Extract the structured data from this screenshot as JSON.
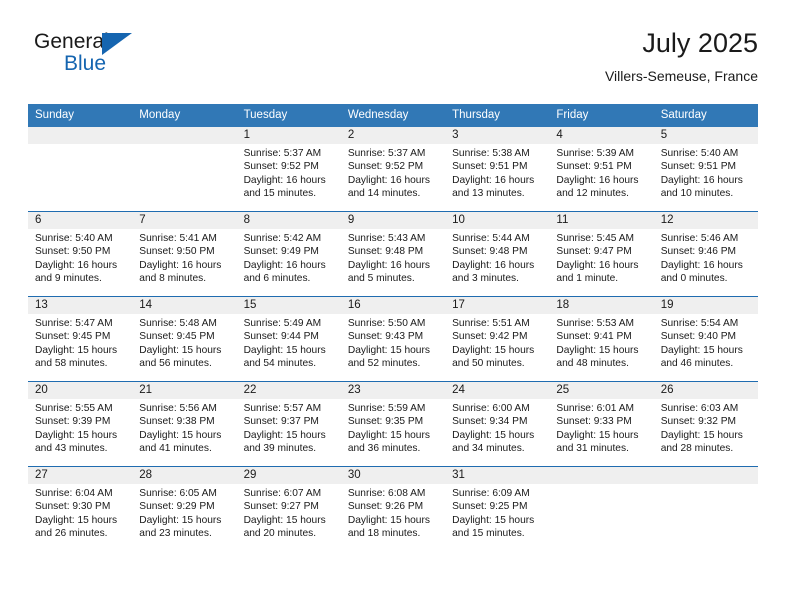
{
  "brand": {
    "name_top": "General",
    "name_bottom": "Blue",
    "flag_icon": "blue-triangle-flag-icon",
    "accent_color": "#1565b0"
  },
  "header": {
    "title": "July 2025",
    "subtitle": "Villers-Semeuse, France"
  },
  "colors": {
    "header_bar": "#3178b6",
    "row_separator": "#1f6cb0",
    "daynum_strip": "#efefef",
    "text": "#1a1a1a"
  },
  "weekday_headers": [
    "Sunday",
    "Monday",
    "Tuesday",
    "Wednesday",
    "Thursday",
    "Friday",
    "Saturday"
  ],
  "weeks": [
    [
      {
        "day": "",
        "sunrise": "",
        "sunset": "",
        "daylight_1": "",
        "daylight_2": ""
      },
      {
        "day": "",
        "sunrise": "",
        "sunset": "",
        "daylight_1": "",
        "daylight_2": ""
      },
      {
        "day": "1",
        "sunrise": "Sunrise: 5:37 AM",
        "sunset": "Sunset: 9:52 PM",
        "daylight_1": "Daylight: 16 hours",
        "daylight_2": "and 15 minutes."
      },
      {
        "day": "2",
        "sunrise": "Sunrise: 5:37 AM",
        "sunset": "Sunset: 9:52 PM",
        "daylight_1": "Daylight: 16 hours",
        "daylight_2": "and 14 minutes."
      },
      {
        "day": "3",
        "sunrise": "Sunrise: 5:38 AM",
        "sunset": "Sunset: 9:51 PM",
        "daylight_1": "Daylight: 16 hours",
        "daylight_2": "and 13 minutes."
      },
      {
        "day": "4",
        "sunrise": "Sunrise: 5:39 AM",
        "sunset": "Sunset: 9:51 PM",
        "daylight_1": "Daylight: 16 hours",
        "daylight_2": "and 12 minutes."
      },
      {
        "day": "5",
        "sunrise": "Sunrise: 5:40 AM",
        "sunset": "Sunset: 9:51 PM",
        "daylight_1": "Daylight: 16 hours",
        "daylight_2": "and 10 minutes."
      }
    ],
    [
      {
        "day": "6",
        "sunrise": "Sunrise: 5:40 AM",
        "sunset": "Sunset: 9:50 PM",
        "daylight_1": "Daylight: 16 hours",
        "daylight_2": "and 9 minutes."
      },
      {
        "day": "7",
        "sunrise": "Sunrise: 5:41 AM",
        "sunset": "Sunset: 9:50 PM",
        "daylight_1": "Daylight: 16 hours",
        "daylight_2": "and 8 minutes."
      },
      {
        "day": "8",
        "sunrise": "Sunrise: 5:42 AM",
        "sunset": "Sunset: 9:49 PM",
        "daylight_1": "Daylight: 16 hours",
        "daylight_2": "and 6 minutes."
      },
      {
        "day": "9",
        "sunrise": "Sunrise: 5:43 AM",
        "sunset": "Sunset: 9:48 PM",
        "daylight_1": "Daylight: 16 hours",
        "daylight_2": "and 5 minutes."
      },
      {
        "day": "10",
        "sunrise": "Sunrise: 5:44 AM",
        "sunset": "Sunset: 9:48 PM",
        "daylight_1": "Daylight: 16 hours",
        "daylight_2": "and 3 minutes."
      },
      {
        "day": "11",
        "sunrise": "Sunrise: 5:45 AM",
        "sunset": "Sunset: 9:47 PM",
        "daylight_1": "Daylight: 16 hours",
        "daylight_2": "and 1 minute."
      },
      {
        "day": "12",
        "sunrise": "Sunrise: 5:46 AM",
        "sunset": "Sunset: 9:46 PM",
        "daylight_1": "Daylight: 16 hours",
        "daylight_2": "and 0 minutes."
      }
    ],
    [
      {
        "day": "13",
        "sunrise": "Sunrise: 5:47 AM",
        "sunset": "Sunset: 9:45 PM",
        "daylight_1": "Daylight: 15 hours",
        "daylight_2": "and 58 minutes."
      },
      {
        "day": "14",
        "sunrise": "Sunrise: 5:48 AM",
        "sunset": "Sunset: 9:45 PM",
        "daylight_1": "Daylight: 15 hours",
        "daylight_2": "and 56 minutes."
      },
      {
        "day": "15",
        "sunrise": "Sunrise: 5:49 AM",
        "sunset": "Sunset: 9:44 PM",
        "daylight_1": "Daylight: 15 hours",
        "daylight_2": "and 54 minutes."
      },
      {
        "day": "16",
        "sunrise": "Sunrise: 5:50 AM",
        "sunset": "Sunset: 9:43 PM",
        "daylight_1": "Daylight: 15 hours",
        "daylight_2": "and 52 minutes."
      },
      {
        "day": "17",
        "sunrise": "Sunrise: 5:51 AM",
        "sunset": "Sunset: 9:42 PM",
        "daylight_1": "Daylight: 15 hours",
        "daylight_2": "and 50 minutes."
      },
      {
        "day": "18",
        "sunrise": "Sunrise: 5:53 AM",
        "sunset": "Sunset: 9:41 PM",
        "daylight_1": "Daylight: 15 hours",
        "daylight_2": "and 48 minutes."
      },
      {
        "day": "19",
        "sunrise": "Sunrise: 5:54 AM",
        "sunset": "Sunset: 9:40 PM",
        "daylight_1": "Daylight: 15 hours",
        "daylight_2": "and 46 minutes."
      }
    ],
    [
      {
        "day": "20",
        "sunrise": "Sunrise: 5:55 AM",
        "sunset": "Sunset: 9:39 PM",
        "daylight_1": "Daylight: 15 hours",
        "daylight_2": "and 43 minutes."
      },
      {
        "day": "21",
        "sunrise": "Sunrise: 5:56 AM",
        "sunset": "Sunset: 9:38 PM",
        "daylight_1": "Daylight: 15 hours",
        "daylight_2": "and 41 minutes."
      },
      {
        "day": "22",
        "sunrise": "Sunrise: 5:57 AM",
        "sunset": "Sunset: 9:37 PM",
        "daylight_1": "Daylight: 15 hours",
        "daylight_2": "and 39 minutes."
      },
      {
        "day": "23",
        "sunrise": "Sunrise: 5:59 AM",
        "sunset": "Sunset: 9:35 PM",
        "daylight_1": "Daylight: 15 hours",
        "daylight_2": "and 36 minutes."
      },
      {
        "day": "24",
        "sunrise": "Sunrise: 6:00 AM",
        "sunset": "Sunset: 9:34 PM",
        "daylight_1": "Daylight: 15 hours",
        "daylight_2": "and 34 minutes."
      },
      {
        "day": "25",
        "sunrise": "Sunrise: 6:01 AM",
        "sunset": "Sunset: 9:33 PM",
        "daylight_1": "Daylight: 15 hours",
        "daylight_2": "and 31 minutes."
      },
      {
        "day": "26",
        "sunrise": "Sunrise: 6:03 AM",
        "sunset": "Sunset: 9:32 PM",
        "daylight_1": "Daylight: 15 hours",
        "daylight_2": "and 28 minutes."
      }
    ],
    [
      {
        "day": "27",
        "sunrise": "Sunrise: 6:04 AM",
        "sunset": "Sunset: 9:30 PM",
        "daylight_1": "Daylight: 15 hours",
        "daylight_2": "and 26 minutes."
      },
      {
        "day": "28",
        "sunrise": "Sunrise: 6:05 AM",
        "sunset": "Sunset: 9:29 PM",
        "daylight_1": "Daylight: 15 hours",
        "daylight_2": "and 23 minutes."
      },
      {
        "day": "29",
        "sunrise": "Sunrise: 6:07 AM",
        "sunset": "Sunset: 9:27 PM",
        "daylight_1": "Daylight: 15 hours",
        "daylight_2": "and 20 minutes."
      },
      {
        "day": "30",
        "sunrise": "Sunrise: 6:08 AM",
        "sunset": "Sunset: 9:26 PM",
        "daylight_1": "Daylight: 15 hours",
        "daylight_2": "and 18 minutes."
      },
      {
        "day": "31",
        "sunrise": "Sunrise: 6:09 AM",
        "sunset": "Sunset: 9:25 PM",
        "daylight_1": "Daylight: 15 hours",
        "daylight_2": "and 15 minutes."
      },
      {
        "day": "",
        "sunrise": "",
        "sunset": "",
        "daylight_1": "",
        "daylight_2": ""
      },
      {
        "day": "",
        "sunrise": "",
        "sunset": "",
        "daylight_1": "",
        "daylight_2": ""
      }
    ]
  ]
}
